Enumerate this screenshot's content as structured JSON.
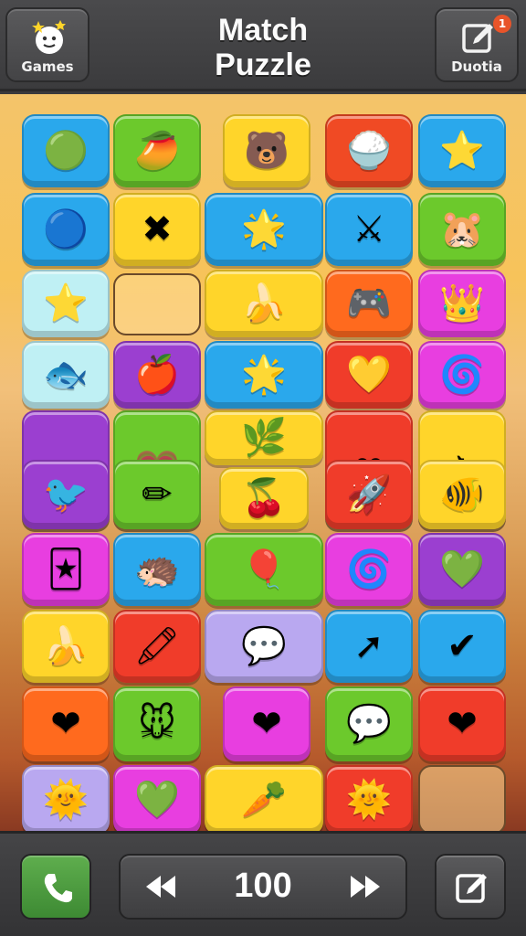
{
  "header": {
    "title_line1": "Match",
    "title_line2": "Puzzle",
    "left_button_label": "Games",
    "right_button_label": "Duotia",
    "notification_count": "1"
  },
  "footer": {
    "score": "100"
  },
  "colors": {
    "blue": "#2aa8ec",
    "green": "#6cc92c",
    "yellow": "#ffd52a",
    "orange": "#ff6a1e",
    "red": "#f03c2a",
    "purple": "#9b3fd0",
    "magenta": "#e83ee0",
    "lightblue": "#bff0f4",
    "lavender": "#b9a8f0"
  },
  "tiles": [
    {
      "name": "green-blob-tile",
      "icon": "green-blob",
      "glyph": "🟢",
      "color": "#2aa8ec"
    },
    {
      "name": "mango-tile",
      "icon": "mango",
      "glyph": "🥭",
      "color": "#6cc92c"
    },
    {
      "name": "brown-bear-tile",
      "icon": "bear-face",
      "glyph": "🐻",
      "color": "#ffd52a"
    },
    {
      "name": "bowl-tile",
      "icon": "bowl",
      "glyph": "🍚",
      "color": "#f04a24"
    },
    {
      "name": "starfish-tile",
      "icon": "starfish",
      "glyph": "⭐",
      "color": "#2aa8ec"
    },
    {
      "name": "blue-blob-tile",
      "icon": "blue-blob",
      "glyph": "🔵",
      "color": "#2aa8ec"
    },
    {
      "name": "pink-cross-tile",
      "icon": "pink-cross",
      "glyph": "✖",
      "color": "#ffd52a"
    },
    {
      "name": "star-arc-tile",
      "icon": "star-arc",
      "glyph": "🌟",
      "color": "#2aa8ec"
    },
    {
      "name": "crossed-swords-tile",
      "icon": "crossed-swords",
      "glyph": "⚔",
      "color": "#2aa8ec"
    },
    {
      "name": "yellow-bear-tile",
      "icon": "yellow-bear",
      "glyph": "🐹",
      "color": "#6cc92c"
    },
    {
      "name": "star-tile",
      "icon": "star",
      "glyph": "⭐",
      "color": "#bff0f4"
    },
    {
      "name": "empty-slot-1",
      "icon": "empty",
      "glyph": "",
      "color": ""
    },
    {
      "name": "banana-tile",
      "icon": "banana",
      "glyph": "🍌",
      "color": "#ffd52a"
    },
    {
      "name": "controller-tile",
      "icon": "game-controller",
      "glyph": "🎮",
      "color": "#ff6a1e"
    },
    {
      "name": "crown-tile",
      "icon": "crown",
      "glyph": "👑",
      "color": "#e83ee0"
    },
    {
      "name": "fish-tile",
      "icon": "fish",
      "glyph": "🐟",
      "color": "#bff0f4"
    },
    {
      "name": "apple-tile",
      "icon": "apple",
      "glyph": "🍎",
      "color": "#9b3fd0"
    },
    {
      "name": "star-arc-tile-2",
      "icon": "star-arc",
      "glyph": "🌟",
      "color": "#2aa8ec"
    },
    {
      "name": "yellow-heart-tile",
      "icon": "yellow-heart",
      "glyph": "💛",
      "color": "#f03c2a"
    },
    {
      "name": "pink-swirl-tile",
      "icon": "pink-swirl",
      "glyph": "🌀",
      "color": "#e83ee0"
    },
    {
      "name": "triangle-tile",
      "icon": "green-triangle",
      "glyph": "🔺",
      "color": "#9b3fd0"
    },
    {
      "name": "pink-heart-tile",
      "icon": "pink-heart",
      "glyph": "💗",
      "color": "#6cc92c"
    },
    {
      "name": "leaf-tile",
      "icon": "leaf",
      "glyph": "🌿",
      "color": "#ffd52a"
    },
    {
      "name": "red-heart-tile",
      "icon": "red-heart",
      "glyph": "❤",
      "color": "#f03c2a"
    },
    {
      "name": "paper-plane-tile",
      "icon": "paper-plane",
      "glyph": "✈",
      "color": "#ffd52a"
    },
    {
      "name": "red-bird-tile",
      "icon": "red-bird",
      "glyph": "🐦",
      "color": "#9b3fd0"
    },
    {
      "name": "pencil-tile",
      "icon": "pencil",
      "glyph": "✏",
      "color": "#6cc92c"
    },
    {
      "name": "cherries-tile",
      "icon": "cherries",
      "glyph": "🍒",
      "color": "#ffd52a"
    },
    {
      "name": "rocket-tile",
      "icon": "rocket",
      "glyph": "🚀",
      "color": "#f03c2a"
    },
    {
      "name": "pink-fish-tile",
      "icon": "pink-fish",
      "glyph": "🐠",
      "color": "#ffd52a"
    },
    {
      "name": "card-tile",
      "icon": "card",
      "glyph": "🃏",
      "color": "#e83ee0"
    },
    {
      "name": "hedgehog-tile",
      "icon": "hedgehog",
      "glyph": "🦔",
      "color": "#2aa8ec"
    },
    {
      "name": "balloon-tile",
      "icon": "balloon",
      "glyph": "🎈",
      "color": "#6cc92c"
    },
    {
      "name": "spiral-tile",
      "icon": "spiral",
      "glyph": "🌀",
      "color": "#e83ee0"
    },
    {
      "name": "green-heart-tile",
      "icon": "green-heart",
      "glyph": "💚",
      "color": "#9b3fd0"
    },
    {
      "name": "banana-tile-2",
      "icon": "banana",
      "glyph": "🍌",
      "color": "#ffd52a"
    },
    {
      "name": "crayon-tile",
      "icon": "crayon",
      "glyph": "🖍",
      "color": "#f03c2a"
    },
    {
      "name": "speech-bubble-tile",
      "icon": "speech-bubble",
      "glyph": "💬",
      "color": "#b9a8f0"
    },
    {
      "name": "arrow-tile",
      "icon": "arrow",
      "glyph": "➚",
      "color": "#2aa8ec"
    },
    {
      "name": "check-circle-tile",
      "icon": "check-circle",
      "glyph": "✔",
      "color": "#2aa8ec"
    },
    {
      "name": "heart-tile-orange",
      "icon": "red-heart",
      "glyph": "❤",
      "color": "#ff6a1e"
    },
    {
      "name": "mouse-tile",
      "icon": "mouse-face",
      "glyph": "🐭",
      "color": "#6cc92c"
    },
    {
      "name": "heart-tile-magenta",
      "icon": "white-heart",
      "glyph": "❤",
      "color": "#e83ee0"
    },
    {
      "name": "chat-dots-tile",
      "icon": "chat-dots",
      "glyph": "💬",
      "color": "#6cc92c"
    },
    {
      "name": "heart-tile-red",
      "icon": "white-heart",
      "glyph": "❤",
      "color": "#f03c2a"
    },
    {
      "name": "sun-tile",
      "icon": "sun",
      "glyph": "🌞",
      "color": "#b9a8f0"
    },
    {
      "name": "green-heart-tile-2",
      "icon": "green-heart",
      "glyph": "💚",
      "color": "#e83ee0"
    },
    {
      "name": "carrot-tile",
      "icon": "carrot",
      "glyph": "🥕",
      "color": "#ffd52a"
    },
    {
      "name": "sun-face-tile",
      "icon": "sun-face",
      "glyph": "🌞",
      "color": "#f03c2a"
    },
    {
      "name": "empty-slot-2",
      "icon": "empty",
      "glyph": "",
      "color": ""
    }
  ]
}
